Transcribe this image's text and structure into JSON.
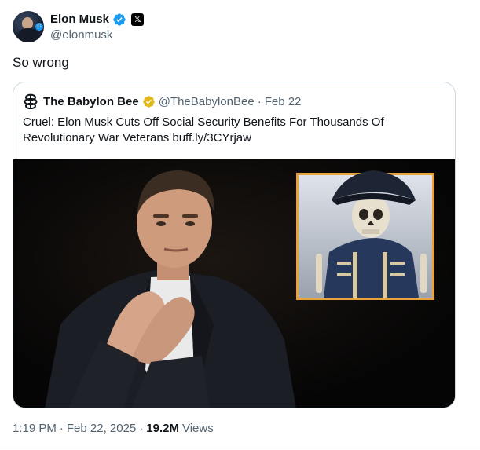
{
  "author": {
    "display_name": "Elon Musk",
    "handle": "@elonmusk",
    "verified_color": "#1d9bf0",
    "affiliate_badge": "x-logo-icon"
  },
  "tweet": {
    "text": "So wrong"
  },
  "quoted": {
    "display_name": "The Babylon Bee",
    "handle": "@TheBabylonBee",
    "separator": "·",
    "date": "Feb 22",
    "verified_color": "#e2b719",
    "text": "Cruel: Elon Musk Cuts Off Social Security Benefits For Thousands Of Revolutionary War Veterans buff.ly/3CYrjaw",
    "media": {
      "description_icon": "photo-icon",
      "inset_border_color": "#e8a33a"
    }
  },
  "meta": {
    "time": "1:19 PM",
    "separator": "·",
    "date": "Feb 22, 2025",
    "views_count": "19.2M",
    "views_label": "Views"
  }
}
